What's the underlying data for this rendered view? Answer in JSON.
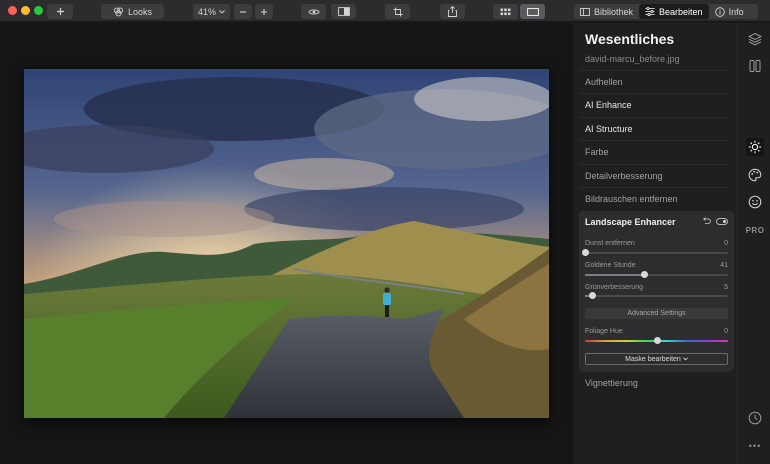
{
  "toolbar": {
    "looks_label": "Looks",
    "zoom_value": "41%",
    "bibliothek_label": "Bibliothek",
    "bearbeiten_label": "Bearbeiten",
    "info_label": "Info"
  },
  "panel": {
    "title": "Wesentliches",
    "filename": "david-marcu_before.jpg",
    "sections": [
      "Aufhellen",
      "AI Enhance",
      "AI Structure",
      "Farbe",
      "Detailverbesserung",
      "Bildrauschen entfernen"
    ],
    "vignette": "Vignettierung"
  },
  "card": {
    "title": "Landscape Enhancer",
    "sliders": [
      {
        "label": "Dunst entfernen",
        "value": "0",
        "level": 0
      },
      {
        "label": "Goldene Stunde",
        "value": "41",
        "level": 41
      },
      {
        "label": "Grünverbesserung",
        "value": "5",
        "level": 5
      }
    ],
    "advanced_label": "Advanced Settings",
    "hue": {
      "label": "Foliage Hue",
      "value": "0",
      "level": 50
    },
    "mask_label": "Maske bearbeiten"
  },
  "rail": {
    "pro_label": "PRO",
    "more_label": "•••"
  },
  "colors": {
    "accent_traffic_red": "#fe5f57",
    "accent_traffic_yellow": "#febc2e",
    "accent_traffic_green": "#28c840",
    "panel_bg": "#1f1f21",
    "card_bg": "#2d2d30"
  }
}
